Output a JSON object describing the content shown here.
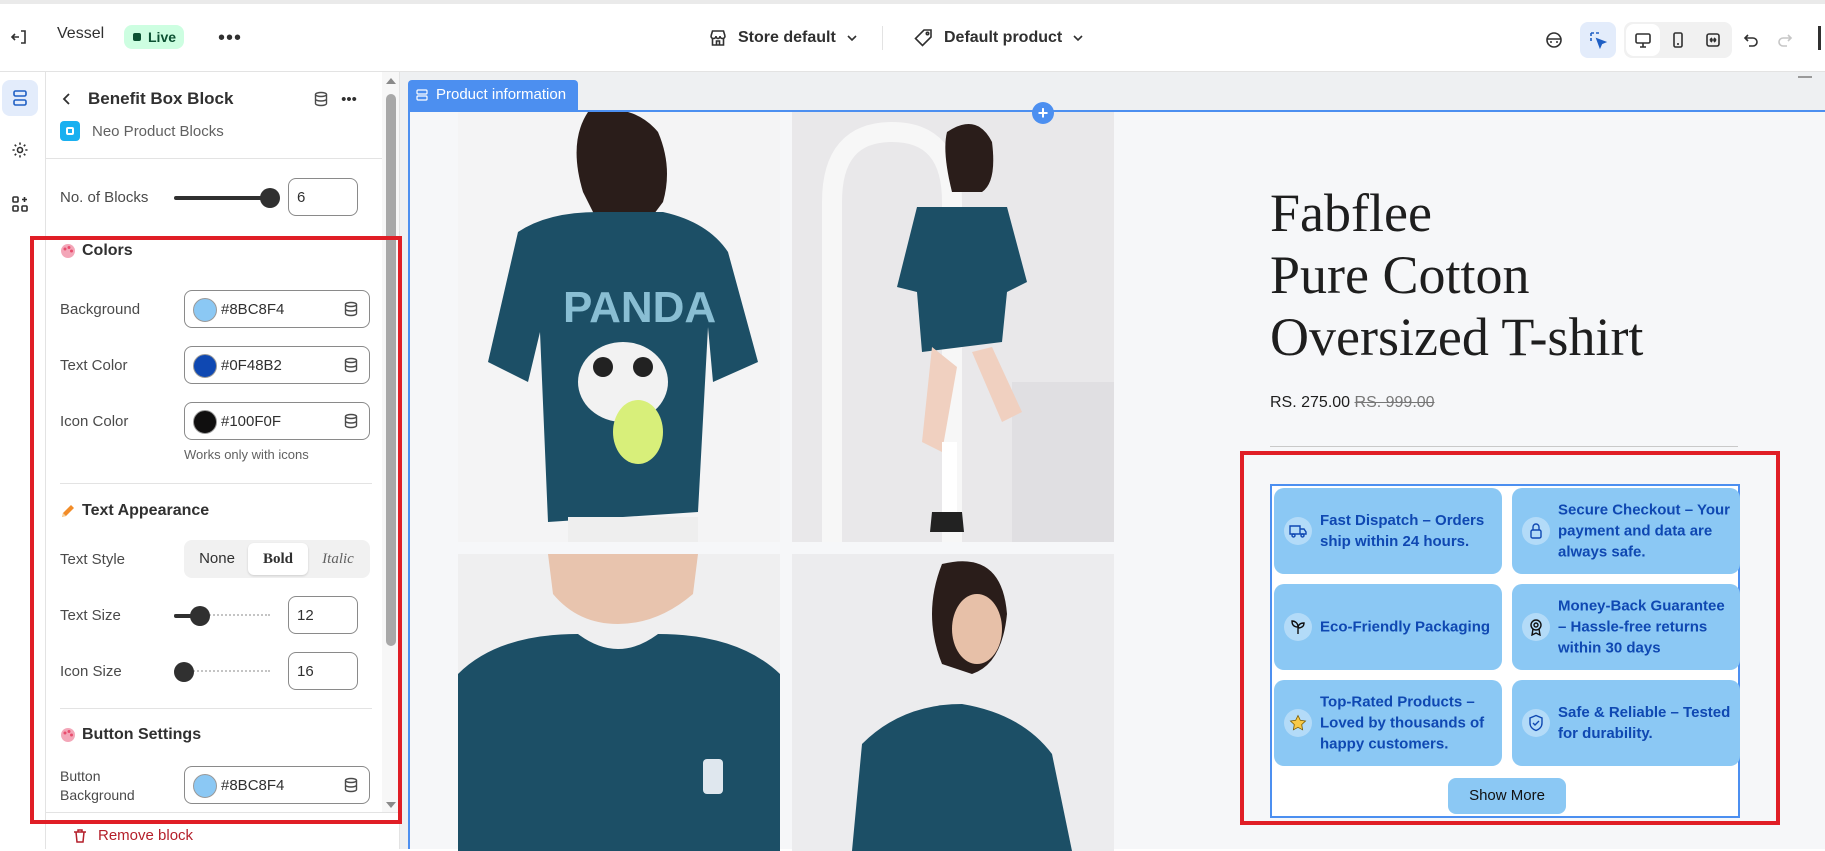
{
  "topbar": {
    "store_name": "Vessel",
    "status_badge": "Live",
    "store_selector": "Store default",
    "product_selector": "Default product"
  },
  "panel": {
    "title": "Benefit Box Block",
    "app_name": "Neo Product Blocks",
    "blocks_label": "No. of Blocks",
    "blocks_value": "6",
    "blocks_slider_fraction": 1.0,
    "colors": {
      "heading": "Colors",
      "background_label": "Background",
      "background_value": "#8BC8F4",
      "text_color_label": "Text Color",
      "text_color_value": "#0F48B2",
      "icon_color_label": "Icon Color",
      "icon_color_value": "#100F0F",
      "icon_hint": "Works only with icons"
    },
    "text_appearance": {
      "heading": "Text Appearance",
      "style_label": "Text Style",
      "style_options": [
        "None",
        "Bold",
        "Italic"
      ],
      "style_selected": "Bold",
      "size_label": "Text Size",
      "size_value": "12",
      "size_slider_fraction": 0.25,
      "icon_size_label": "Icon Size",
      "icon_size_value": "16",
      "icon_slider_fraction": 0.0
    },
    "button_settings": {
      "heading": "Button Settings",
      "bg_label": "Button Background Color",
      "bg_value": "#8BC8F4"
    },
    "remove_block": "Remove block"
  },
  "canvas": {
    "section_tag": "Product information",
    "product_title_lines": [
      "Fabflee",
      "Pure Cotton",
      "Oversized T-shirt"
    ],
    "price": "RS. 275.00",
    "compare_price": "RS. 999.00",
    "benefits": [
      {
        "icon": "truck-icon",
        "text": "Fast Dispatch – Orders ship within 24 hours."
      },
      {
        "icon": "lock-icon",
        "text": "Secure Checkout – Your payment and data are always safe."
      },
      {
        "icon": "leaf-icon",
        "text": "Eco-Friendly Packaging"
      },
      {
        "icon": "award-icon",
        "text": "Money-Back Guarantee – Hassle-free returns within 30 days"
      },
      {
        "icon": "star-icon",
        "text": "Top-Rated Products – Loved by thousands of happy customers."
      },
      {
        "icon": "shield-check-icon",
        "text": "Safe & Reliable – Tested for durability."
      }
    ],
    "show_more": "Show More",
    "photo_graphic_text": "PANDA"
  },
  "colors": {
    "accent": "#4C8FF0",
    "highlight": "#E01E26",
    "live_badge_bg": "#CDFEE1",
    "shirt": "#1C4F66"
  }
}
